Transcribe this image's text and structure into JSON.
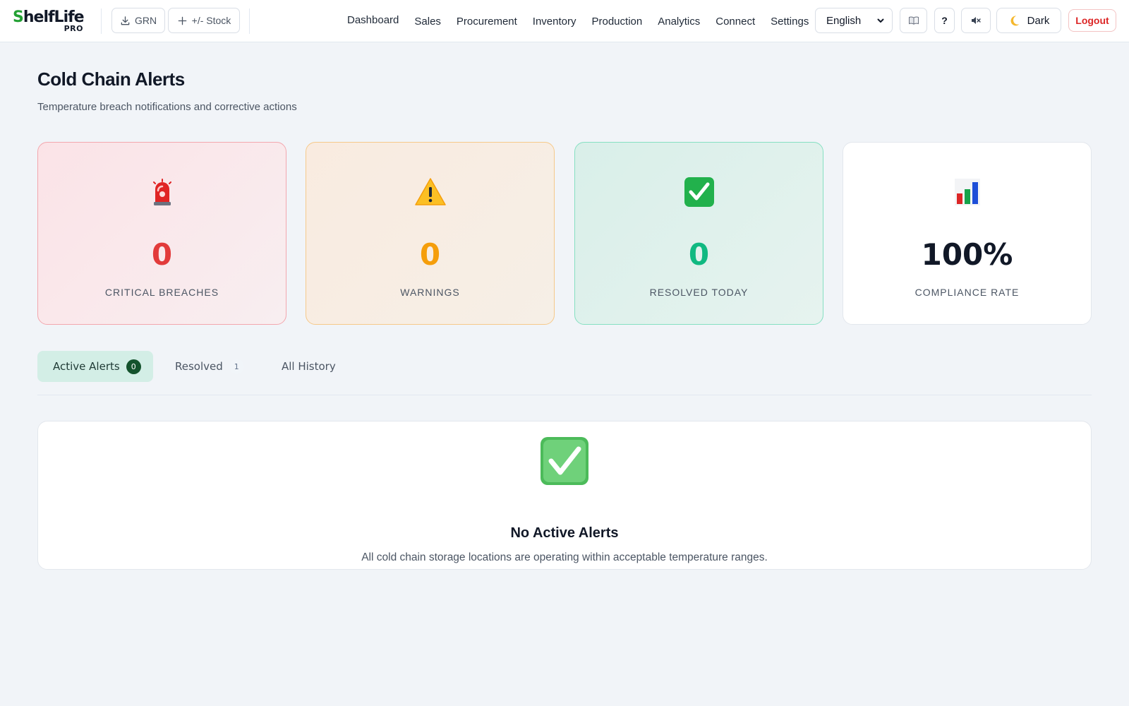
{
  "brand": {
    "name_first_letter": "S",
    "name_rest": "helfLife",
    "tier": "PRO"
  },
  "toolbar": {
    "grn_label": "GRN",
    "stock_label": "+/- Stock"
  },
  "nav": {
    "items": [
      "Dashboard",
      "Sales",
      "Procurement",
      "Inventory",
      "Production",
      "Analytics",
      "Connect",
      "Settings"
    ]
  },
  "header_controls": {
    "language": "English",
    "help_label": "?",
    "theme_label": "Dark",
    "logout_label": "Logout"
  },
  "page": {
    "title": "Cold Chain Alerts",
    "subtitle": "Temperature breach notifications and corrective actions"
  },
  "stats": [
    {
      "icon": "siren-icon",
      "value": "0",
      "label": "CRITICAL BREACHES",
      "color": "#e23b3b"
    },
    {
      "icon": "warning-icon",
      "value": "0",
      "label": "WARNINGS",
      "color": "#f59e0b"
    },
    {
      "icon": "check-icon",
      "value": "0",
      "label": "RESOLVED TODAY",
      "color": "#10b981"
    },
    {
      "icon": "bar-chart-icon",
      "value": "100%",
      "label": "COMPLIANCE RATE",
      "color": "#111827"
    }
  ],
  "tabs": [
    {
      "label": "Active Alerts",
      "count": "0",
      "active": true
    },
    {
      "label": "Resolved",
      "count": "1",
      "active": false
    },
    {
      "label": "All History",
      "count": "",
      "active": false
    }
  ],
  "empty_state": {
    "title": "No Active Alerts",
    "message": "All cold chain storage locations are operating within acceptable temperature ranges."
  },
  "colors": {
    "accent_green": "#22a033",
    "critical": "#e23b3b",
    "warning": "#f59e0b",
    "success": "#10b981",
    "logout_red": "#dc2626"
  }
}
